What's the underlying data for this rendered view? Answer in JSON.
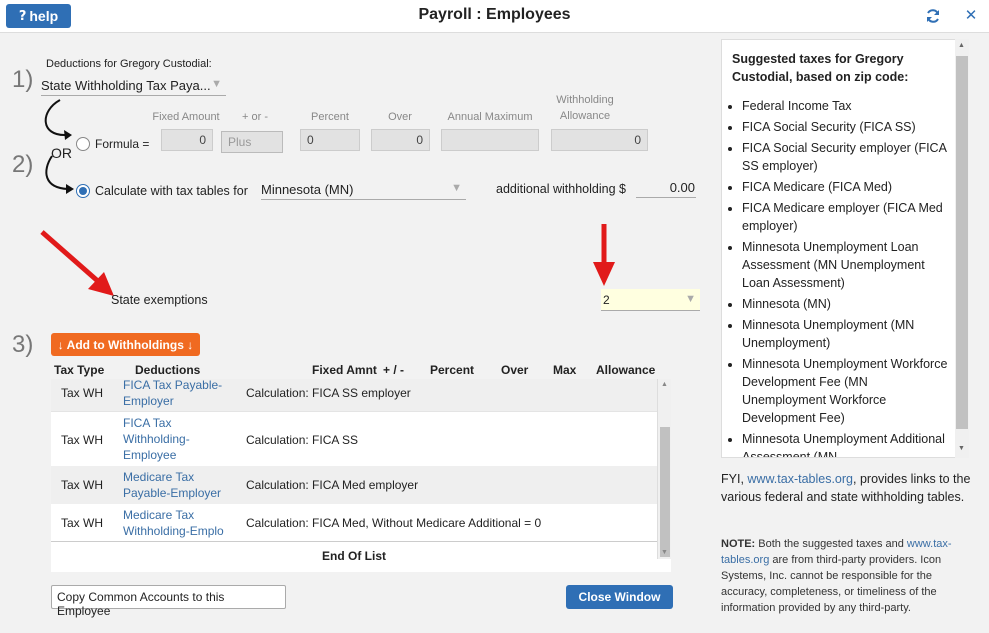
{
  "header": {
    "help_label": "help",
    "title": "Payroll : Employees"
  },
  "step1": {
    "number": "1)",
    "caption": "Deductions for Gregory Custodial:",
    "selected": "State Withholding Tax Paya..."
  },
  "step2": {
    "number": "2)",
    "or_label": "OR",
    "columns": {
      "fixed_amount": "Fixed Amount",
      "plus_or_minus": "+ or -",
      "percent": "Percent",
      "over": "Over",
      "annual_maximum": "Annual Maximum",
      "withholding_allowance_line1": "Withholding",
      "withholding_allowance_line2": "Allowance"
    },
    "formula_label": "Formula =",
    "fixed_amount_value": "0",
    "plus_placeholder": "Plus",
    "percent_value": "0",
    "over_value": "0",
    "annual_max_value": "",
    "allowance_value": "0",
    "calc_label": "Calculate with tax tables for",
    "state_selected": "Minnesota (MN)",
    "additional_label": "additional withholding $",
    "additional_value": "0.00",
    "exemptions_label": "State exemptions",
    "exemptions_value": "2"
  },
  "step3": {
    "number": "3)",
    "add_button": "↓ Add to Withholdings ↓",
    "columns": [
      "Tax Type",
      "Deductions",
      "Fixed Amnt",
      "+ / -",
      "Percent",
      "Over",
      "Max",
      "Allowance"
    ],
    "rows": [
      {
        "tax_type": "Tax WH",
        "deduction": "FICA Tax Payable-Employer",
        "calculation": "Calculation: FICA SS employer"
      },
      {
        "tax_type": "Tax WH",
        "deduction": "FICA Tax Withholding-Employee",
        "calculation": "Calculation: FICA SS"
      },
      {
        "tax_type": "Tax WH",
        "deduction": "Medicare Tax Payable-Employer",
        "calculation": "Calculation: FICA Med employer"
      },
      {
        "tax_type": "Tax WH",
        "deduction": "Medicare Tax Withholding-Emplo",
        "calculation": "Calculation: FICA Med, Without Medicare Additional = 0"
      }
    ],
    "end_of_list": "End Of List"
  },
  "footer": {
    "copy_button": "Copy Common Accounts to this Employee",
    "close_button": "Close Window"
  },
  "sidebar": {
    "heading": "Suggested taxes for Gregory Custodial, based on zip code:",
    "items": [
      "Federal Income Tax",
      "FICA Social Security (FICA SS)",
      "FICA Social Security employer (FICA SS employer)",
      "FICA Medicare (FICA Med)",
      "FICA Medicare employer (FICA Med employer)",
      "Minnesota Unemployment Loan Assessment (MN Unemployment Loan Assessment)",
      "Minnesota (MN)",
      "Minnesota Unemployment (MN Unemployment)",
      "Minnesota Unemployment Workforce Development Fee (MN Unemployment Workforce Development Fee)",
      "Minnesota Unemployment Additional Assessment (MN"
    ],
    "fyi_prefix": "FYI,",
    "fyi_link": "www.tax-tables.org",
    "fyi_suffix": ", provides links to the various federal and state withholding tables.",
    "note_label": "NOTE:",
    "note_part1": "Both the suggested taxes and",
    "note_link": "www.tax-tables.org",
    "note_part2": "are from third-party providers. Icon Systems, Inc. cannot be responsible for the accuracy, completeness, or timeliness of the information provided by any third-party."
  },
  "colors": {
    "accent_blue": "#2f6fb5",
    "orange": "#f06a21",
    "arrow_red": "#e11a1a",
    "link": "#3a6ea5"
  }
}
